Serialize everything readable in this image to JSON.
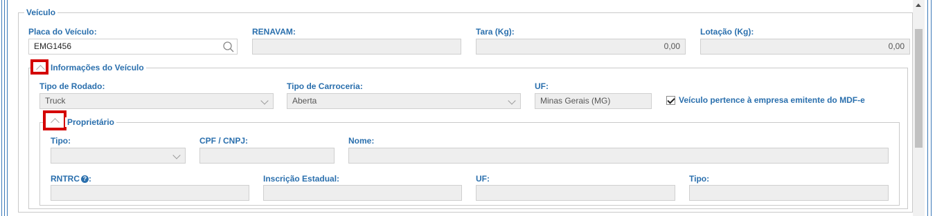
{
  "veiculo": {
    "legend": "Veículo",
    "placa": {
      "label": "Placa do Veículo:",
      "value": "EMG1456"
    },
    "renavam": {
      "label": "RENAVAM:",
      "value": ""
    },
    "tara": {
      "label": "Tara (Kg):",
      "value": "0,00"
    },
    "lotacao": {
      "label": "Lotação (Kg):",
      "value": "0,00"
    }
  },
  "informacoes": {
    "legend": "Informações do Veículo",
    "tipo_rodado": {
      "label": "Tipo de Rodado:",
      "value": "Truck"
    },
    "tipo_carroceria": {
      "label": "Tipo de Carroceria:",
      "value": "Aberta"
    },
    "uf": {
      "label": "UF:",
      "value": "Minas Gerais (MG)"
    },
    "pertence_empresa": {
      "label": "Veículo pertence à empresa emitente do MDF-e",
      "checked": true
    }
  },
  "proprietario": {
    "legend": "Proprietário",
    "tipo": {
      "label": "Tipo:",
      "value": ""
    },
    "cpf_cnpj": {
      "label": "CPF / CNPJ:",
      "value": ""
    },
    "nome": {
      "label": "Nome:",
      "value": ""
    },
    "rntrc": {
      "label": "RNTRC",
      "value": ""
    },
    "inscricao_estadual": {
      "label": "Inscrição Estadual:",
      "value": ""
    },
    "uf": {
      "label": "UF:",
      "value": ""
    },
    "tipo2": {
      "label": "Tipo:",
      "value": ""
    }
  },
  "colors": {
    "accent": "#2a6fad",
    "highlight": "#d40000"
  }
}
